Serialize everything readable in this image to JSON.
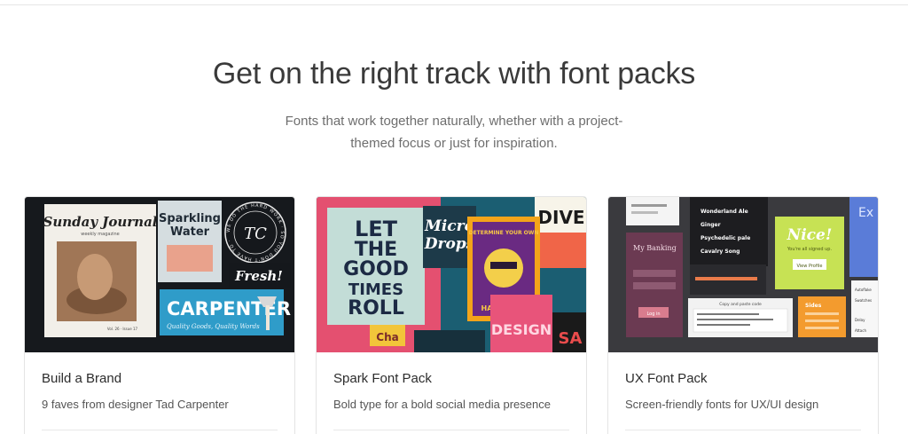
{
  "header": {
    "title": "Get on the right track with font packs",
    "subtitle": "Fonts that work together naturally, whether with a project-themed focus or just for inspiration."
  },
  "cards": [
    {
      "title": "Build a Brand",
      "description": "9 faves from designer Tad Carpenter",
      "art": {
        "journal_title": "Sunday Journal",
        "journal_sub": "weekly magazine",
        "journal_issue": "Vol. 26 · Issue 17",
        "sparkling": "Sparkling",
        "water": "Water",
        "badge_ring": "WE DO THE HARD WORK · SO YOU DON'T HAVE TO ·",
        "badge_mono": "TC",
        "fresh": "Fresh!",
        "carpenter": "CARPENTER",
        "carpenter_tagline": "Quality Goods, Quality Words"
      }
    },
    {
      "title": "Spark Font Pack",
      "description": "Bold type for a bold social media presence",
      "art": {
        "poster_lines": [
          "LET",
          "THE",
          "GOOD",
          "TIMES",
          "ROLL"
        ],
        "micro": "Micro",
        "drops": "Drops",
        "dive": "DIVE",
        "determine": "DETERMINE YOUR OWN",
        "happiness": "HAPPINESS",
        "design": "DESIGN",
        "sa": "SA",
        "cha": "Cha"
      }
    },
    {
      "title": "UX Font Pack",
      "description": "Screen-friendly fonts for UX/UI design",
      "art": {
        "banking": "My Banking",
        "login": "Log in",
        "menu_items": [
          "Wonderland Ale",
          "Ginger",
          "Psychedelic pale",
          "Cavalry Song"
        ],
        "nice": "Nice!",
        "signed_up": "You're all signed up.",
        "view_profile": "View Profile",
        "sides": "Sides",
        "copy_paste": "Copy and paste code",
        "ex": "Ex",
        "list_items": [
          "Autoflake",
          "Swatches",
          "Delay",
          "Attach"
        ]
      }
    }
  ]
}
